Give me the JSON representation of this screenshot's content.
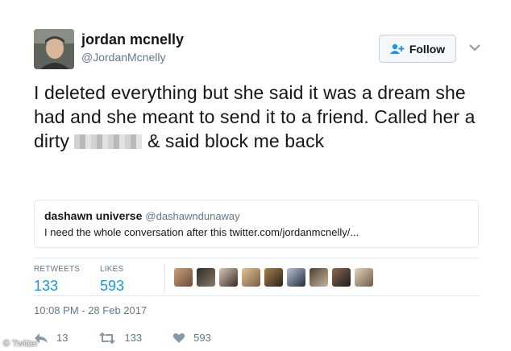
{
  "author": {
    "display_name": "jordan mcnelly",
    "handle": "@JordanMcnelly",
    "avatar_icon": "user-avatar"
  },
  "follow_button": {
    "label": "Follow",
    "icon": "add-user-icon"
  },
  "tweet": {
    "text_part1": "I deleted everything but she said it was a dream she had and she meant to send it to a friend. Called her a dirty",
    "text_part2": "& said block me back"
  },
  "quoted_tweet": {
    "display_name": "dashawn universe",
    "handle": "@dashawndunaway",
    "text": "I need the whole conversation after this twitter.com/jordanmcnelly/..."
  },
  "stats": {
    "retweets_label": "RETWEETS",
    "retweets_value": "133",
    "likes_label": "LIKES",
    "likes_value": "593"
  },
  "timestamp": "10:08 PM - 28 Feb 2017",
  "actions": {
    "reply_count": "13",
    "retweet_count": "133",
    "like_count": "593"
  },
  "credit": "© Twitter",
  "colors": {
    "accent": "#1b95e0",
    "secondary_text": "#657786",
    "border": "#e1e8ed"
  }
}
